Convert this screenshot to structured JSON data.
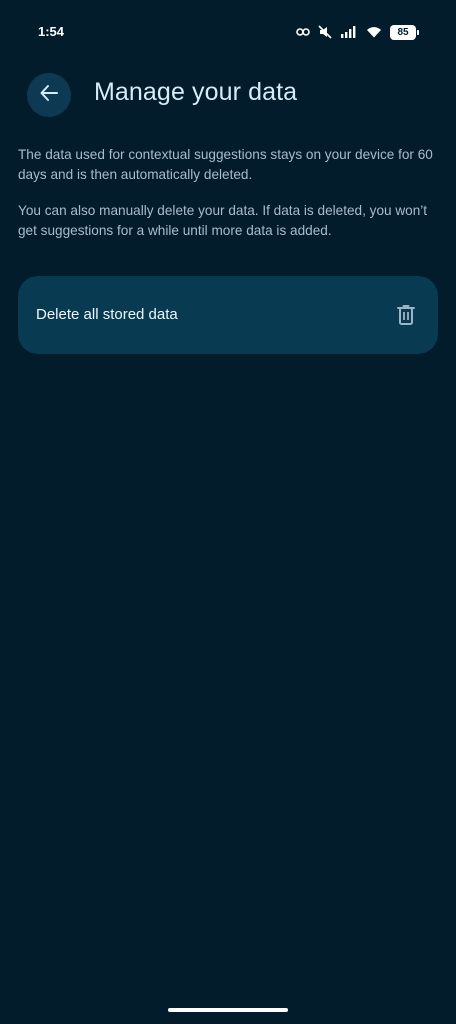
{
  "status_bar": {
    "time": "1:54",
    "battery": "85",
    "icons": [
      "link-icon",
      "mute-icon",
      "signal-icon",
      "wifi-icon",
      "battery-icon"
    ]
  },
  "header": {
    "back_icon": "arrow-left-icon",
    "title": "Manage your data"
  },
  "content": {
    "paragraph_1": "The data used for contextual suggestions stays on your device for 60 days and is then automatically deleted.",
    "paragraph_2": "You can also manually delete your data. If data is deleted, you won’t get suggestions for a while until more data is added."
  },
  "delete_card": {
    "label": "Delete all stored data",
    "icon": "trash-icon"
  },
  "colors": {
    "background": "#021c2c",
    "card": "#083a52",
    "back_button": "#0d3a52",
    "title": "#d6ecf7",
    "body_text": "#a9bccb"
  }
}
